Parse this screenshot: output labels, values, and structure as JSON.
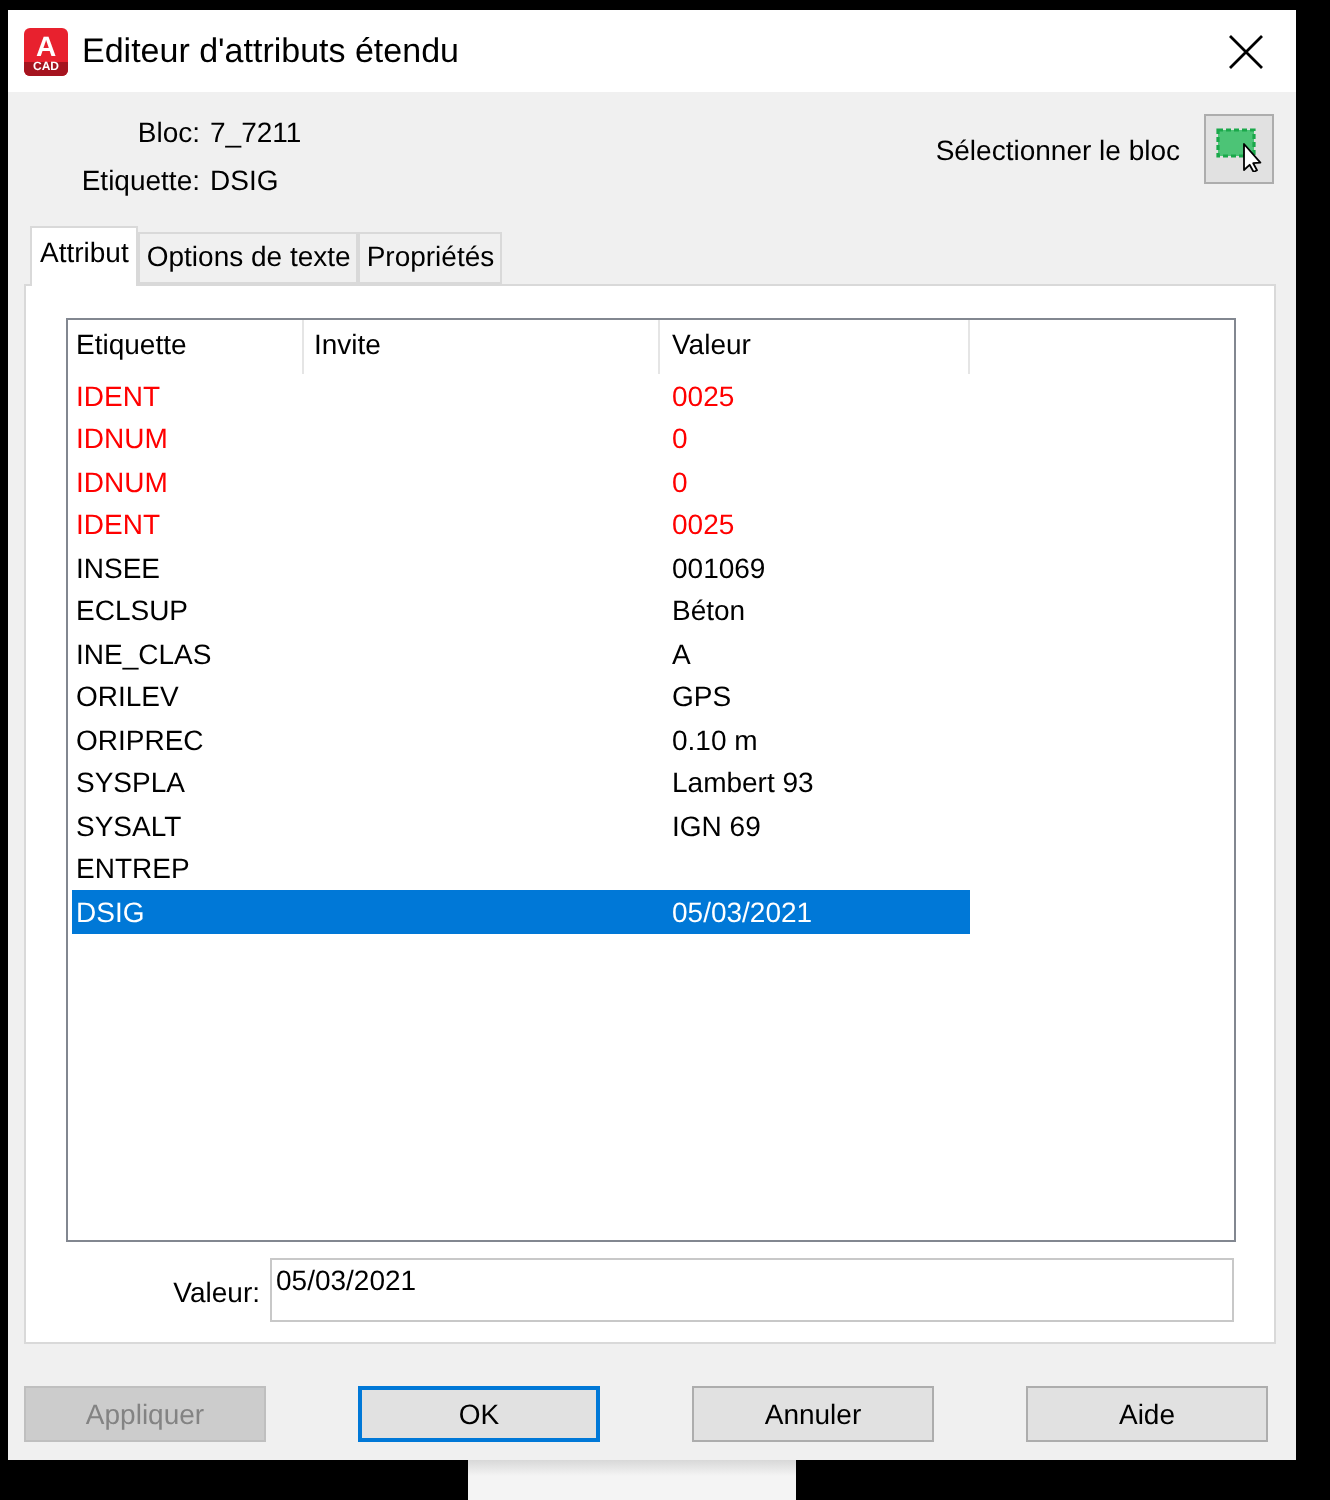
{
  "window": {
    "title": "Editeur d'attributs étendu",
    "logo": {
      "letter": "A",
      "caption": "CAD"
    }
  },
  "block": {
    "label": "Bloc:",
    "value": "7_7211"
  },
  "tag": {
    "label": "Etiquette:",
    "value": "DSIG"
  },
  "select_block": {
    "label": "Sélectionner le bloc"
  },
  "tabs": [
    {
      "label": "Attribut",
      "selected": true
    },
    {
      "label": "Options de texte",
      "selected": false
    },
    {
      "label": "Propriétés",
      "selected": false
    }
  ],
  "table": {
    "columns": [
      "Etiquette",
      "Invite",
      "Valeur"
    ],
    "rows": [
      {
        "tag": "IDENT",
        "value": "0025",
        "color": "#ff0000",
        "selected": false
      },
      {
        "tag": "IDNUM",
        "value": "0",
        "color": "#ff0000",
        "selected": false
      },
      {
        "tag": "IDNUM",
        "value": "0",
        "color": "#ff0000",
        "selected": false
      },
      {
        "tag": "IDENT",
        "value": "0025",
        "color": "#ff0000",
        "selected": false
      },
      {
        "tag": "INSEE",
        "value": "001069",
        "color": "#000000",
        "selected": false
      },
      {
        "tag": "ECLSUP",
        "value": "Béton",
        "color": "#000000",
        "selected": false
      },
      {
        "tag": "INE_CLAS",
        "value": "A",
        "color": "#000000",
        "selected": false
      },
      {
        "tag": "ORILEV",
        "value": "GPS",
        "color": "#000000",
        "selected": false
      },
      {
        "tag": "ORIPREC",
        "value": "0.10 m",
        "color": "#000000",
        "selected": false
      },
      {
        "tag": "SYSPLA",
        "value": "Lambert 93",
        "color": "#000000",
        "selected": false
      },
      {
        "tag": "SYSALT",
        "value": "IGN 69",
        "color": "#000000",
        "selected": false
      },
      {
        "tag": "ENTREP",
        "color": "#000000",
        "selected": false
      },
      {
        "tag": "DSIG",
        "value": "05/03/2021",
        "selected": true
      }
    ]
  },
  "value_field": {
    "label": "Valeur:",
    "value": "05/03/2021"
  },
  "buttons": [
    {
      "label": "Appliquer",
      "disabled": true,
      "default": false
    },
    {
      "label": "OK",
      "disabled": false,
      "default": true
    },
    {
      "label": "Annuler",
      "disabled": false,
      "default": false
    },
    {
      "label": "Aide",
      "disabled": false,
      "default": false
    }
  ]
}
